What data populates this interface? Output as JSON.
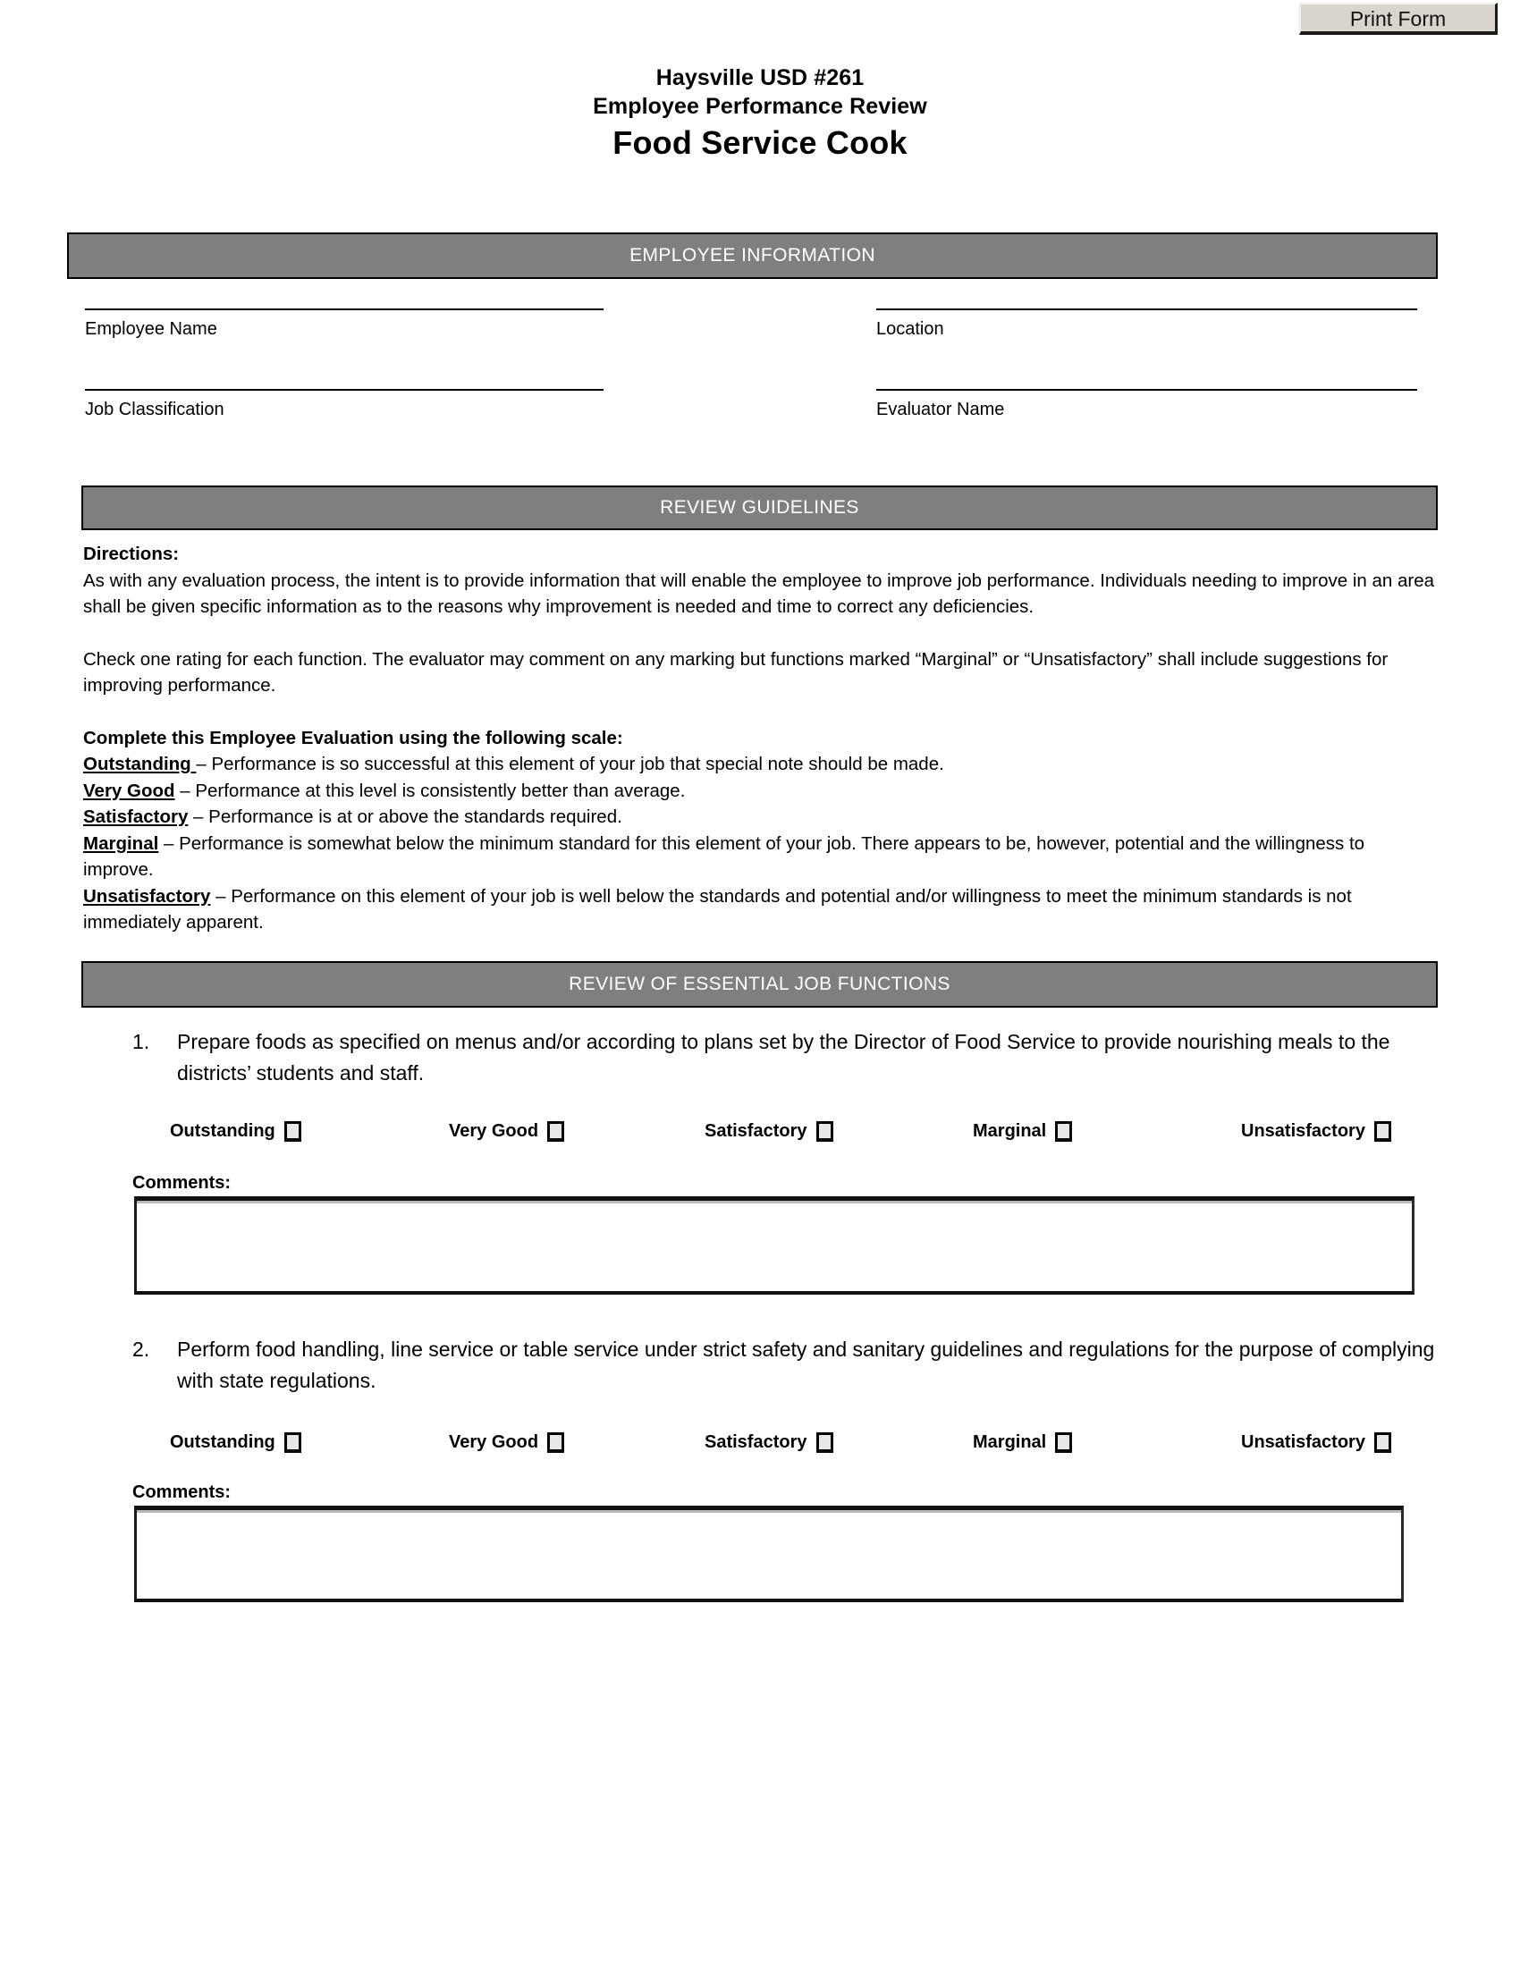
{
  "toolbar": {
    "print_form_label": "Print Form"
  },
  "header": {
    "district": "Haysville USD #261",
    "form_type": "Employee Performance Review",
    "position_title": "Food Service Cook"
  },
  "sections": {
    "employee_information": "EMPLOYEE INFORMATION",
    "review_guidelines": "REVIEW GUIDELINES",
    "review_of_essential_job_functions": "REVIEW OF ESSENTIAL JOB FUNCTIONS"
  },
  "employee_fields": [
    {
      "label": "Employee Name",
      "value": ""
    },
    {
      "label": "Location",
      "value": ""
    },
    {
      "label": "Job Classification",
      "value": ""
    },
    {
      "label": "Evaluator Name",
      "value": ""
    }
  ],
  "guidelines": {
    "directions_heading": "Directions:",
    "directions_paragraph": "As with any evaluation process, the intent is to provide information that will enable the employee to improve job performance.  Individuals needing to improve in an area shall be given specific information as to the reasons why improvement is needed and time to correct any deficiencies.",
    "check_one_paragraph": "Check one rating for each function.  The evaluator may comment on any marking but functions marked “Marginal” or “Unsatisfactory” shall include suggestions for improving performance.",
    "scale_heading": "Complete this Employee Evaluation using the following scale:",
    "scale": [
      {
        "term": "Outstanding ",
        "definition": "– Performance is so successful at this element of your job that special note should be made."
      },
      {
        "term": "Very Good",
        "definition": " – Performance at this level is consistently better than average."
      },
      {
        "term": "Satisfactory",
        "definition": " – Performance is at or above the standards required."
      },
      {
        "term": "Marginal",
        "definition": " – Performance is somewhat below the minimum standard for this element of your job.  There appears to be, however, potential and the willingness to improve."
      },
      {
        "term": "Unsatisfactory",
        "definition": " – Performance on this element of your job is well below the standards and potential and/or willingness to meet the minimum standards is not immediately apparent."
      }
    ]
  },
  "rating_options": [
    "Outstanding",
    "Very Good",
    "Satisfactory",
    "Marginal",
    "Unsatisfactory"
  ],
  "comments_label": "Comments:",
  "job_functions": [
    {
      "number": "1.",
      "text": "Prepare foods as specified on menus and/or according to plans set by the Director of Food Service to provide nourishing meals to the districts’ students and staff.",
      "comments_value": ""
    },
    {
      "number": "2.",
      "text": "Perform food handling, line service or table service under strict safety and sanitary guidelines and regulations for the purpose of complying with state regulations.",
      "comments_value": ""
    }
  ],
  "colors": {
    "band_gray": "#7f7f7f",
    "band_text": "#ffffff",
    "button_face": "#d9d5cc",
    "checkbox_fill": "#e8e8e8",
    "page_background": "#ffffff",
    "text": "#000000"
  }
}
